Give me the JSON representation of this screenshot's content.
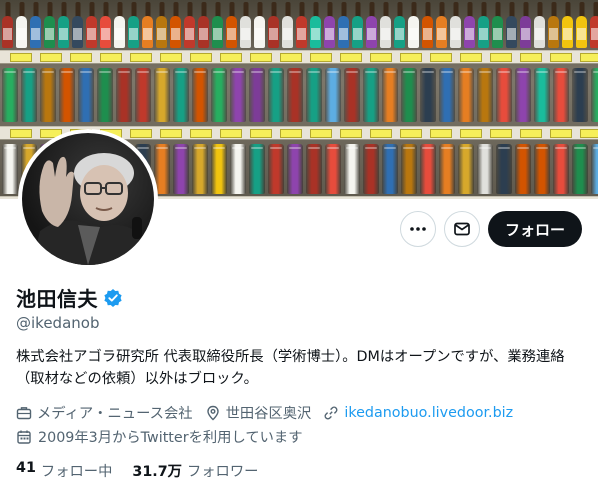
{
  "profile": {
    "display_name": "池田信夫",
    "verified": true,
    "handle": "@ikedanob",
    "bio": "株式会社アゴラ研究所 代表取締役所長（学術博士）。DMはオープンですが、業務連絡（取材などの依頼）以外はブロック。",
    "category": "メディア・ニュース会社",
    "location": "世田谷区奥沢",
    "website": "ikedanobuo.livedoor.biz",
    "joined": "2009年3月からTwitterを利用しています"
  },
  "actions": {
    "more_icon": "more-horizontal-icon",
    "dm_icon": "mail-icon",
    "follow_label": "フォロー"
  },
  "stats": {
    "following_count": "41",
    "following_label": "フォロー中",
    "followers_count": "31.7万",
    "followers_label": "フォロワー"
  },
  "colors": {
    "accent": "#1d9bf0",
    "text_primary": "#0f1419",
    "text_secondary": "#536471",
    "follow_button": "#0f1419"
  }
}
